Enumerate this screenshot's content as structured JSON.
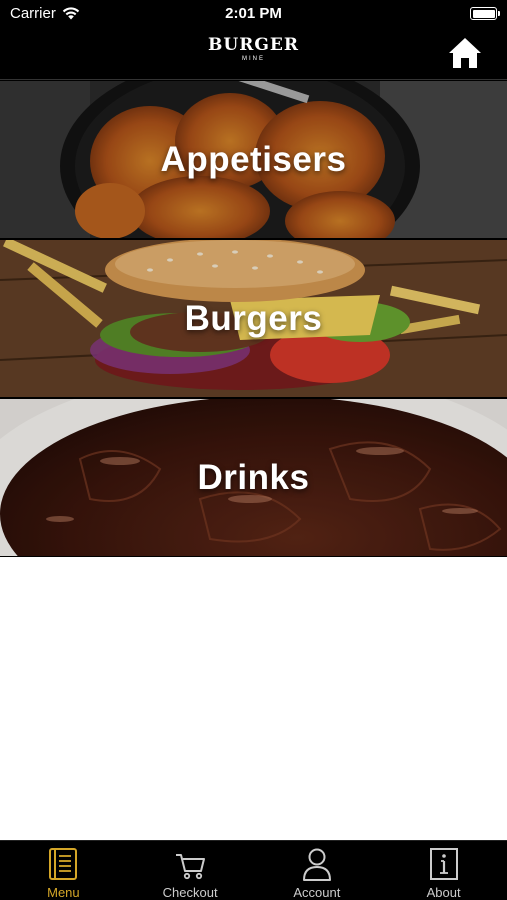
{
  "status_bar": {
    "carrier": "Carrier",
    "time": "2:01 PM"
  },
  "nav": {
    "logo_text": "BURGER",
    "logo_subtext": "MINE"
  },
  "categories": [
    {
      "label": "Appetisers",
      "image": "chicken-wings"
    },
    {
      "label": "Burgers",
      "image": "burger"
    },
    {
      "label": "Drinks",
      "image": "cola"
    }
  ],
  "tabs": [
    {
      "label": "Menu",
      "icon": "menu-book-icon",
      "active": true
    },
    {
      "label": "Checkout",
      "icon": "cart-icon",
      "active": false
    },
    {
      "label": "Account",
      "icon": "person-icon",
      "active": false
    },
    {
      "label": "About",
      "icon": "info-icon",
      "active": false
    }
  ],
  "colors": {
    "accent": "#d4a628",
    "bar_background": "#000000",
    "content_background": "#ffffff"
  }
}
